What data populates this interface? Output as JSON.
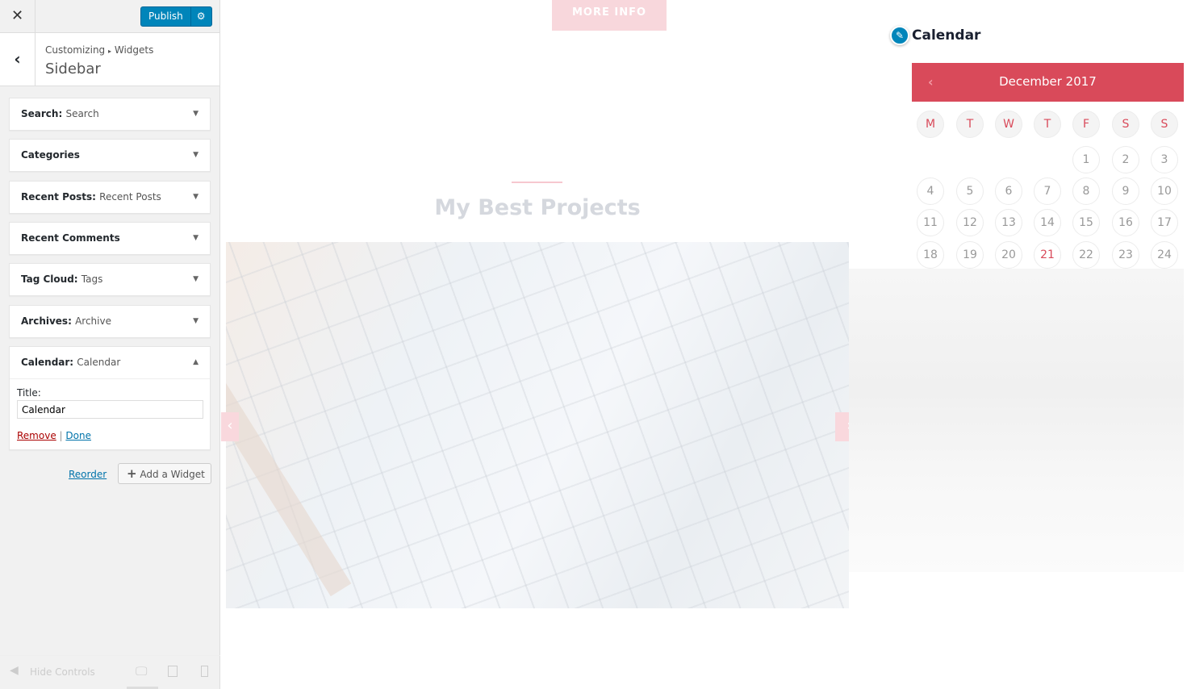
{
  "sidebar": {
    "close_label": "✕",
    "publish_label": "Publish",
    "breadcrumb": [
      "Customizing",
      "Widgets"
    ],
    "breadcrumb_sep": "▸",
    "section_title": "Sidebar",
    "widgets": [
      {
        "type": "Search:",
        "title": "Search",
        "expanded": false
      },
      {
        "type": "Categories",
        "title": "",
        "expanded": false
      },
      {
        "type": "Recent Posts:",
        "title": "Recent Posts",
        "expanded": false
      },
      {
        "type": "Recent Comments",
        "title": "",
        "expanded": false
      },
      {
        "type": "Tag Cloud:",
        "title": "Tags",
        "expanded": false
      },
      {
        "type": "Archives:",
        "title": "Archive",
        "expanded": false
      },
      {
        "type": "Calendar:",
        "title": "Calendar",
        "expanded": true
      }
    ],
    "calendar_form": {
      "title_label": "Title:",
      "title_value": "Calendar",
      "remove_label": "Remove",
      "separator": "|",
      "done_label": "Done"
    },
    "reorder_label": "Reorder",
    "add_widget_label": "Add a Widget",
    "hide_controls_label": "Hide Controls",
    "devices": [
      "desktop",
      "tablet",
      "mobile"
    ]
  },
  "preview": {
    "more_info_label": "MORE INFO",
    "section_title": "My Best Projects",
    "calendar": {
      "widget_title": "Calendar",
      "month": "December 2017",
      "weekdays": [
        "M",
        "T",
        "W",
        "T",
        "F",
        "S",
        "S"
      ],
      "weeks": [
        [
          "",
          "",
          "",
          "",
          "1",
          "2",
          "3"
        ],
        [
          "4",
          "5",
          "6",
          "7",
          "8",
          "9",
          "10"
        ],
        [
          "11",
          "12",
          "13",
          "14",
          "15",
          "16",
          "17"
        ],
        [
          "18",
          "19",
          "20",
          "21",
          "22",
          "23",
          "24"
        ]
      ],
      "today": "21",
      "accent": "#d94a5a"
    }
  },
  "colors": {
    "publish": "#0085ba",
    "accent": "#d94a5a"
  }
}
